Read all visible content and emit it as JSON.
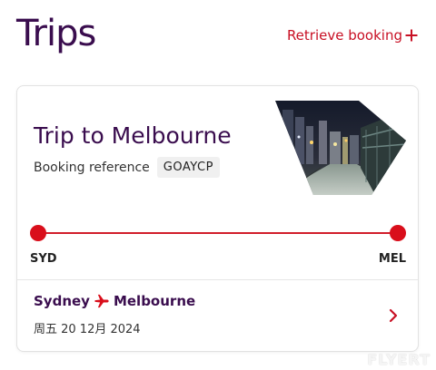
{
  "header": {
    "title": "Trips",
    "retrieve_label": "Retrieve booking"
  },
  "trip": {
    "title": "Trip to Melbourne",
    "reference_label": "Booking reference",
    "reference_code": "GOAYCP",
    "image": "melbourne-city-night-photo",
    "origin_code": "SYD",
    "destination_code": "MEL",
    "flight": {
      "origin_city": "Sydney",
      "destination_city": "Melbourne",
      "date": "周五 20 12月 2024"
    }
  },
  "colors": {
    "brand_purple": "#3a0d4e",
    "brand_red": "#d90e1b"
  },
  "watermark": "FLYERT"
}
